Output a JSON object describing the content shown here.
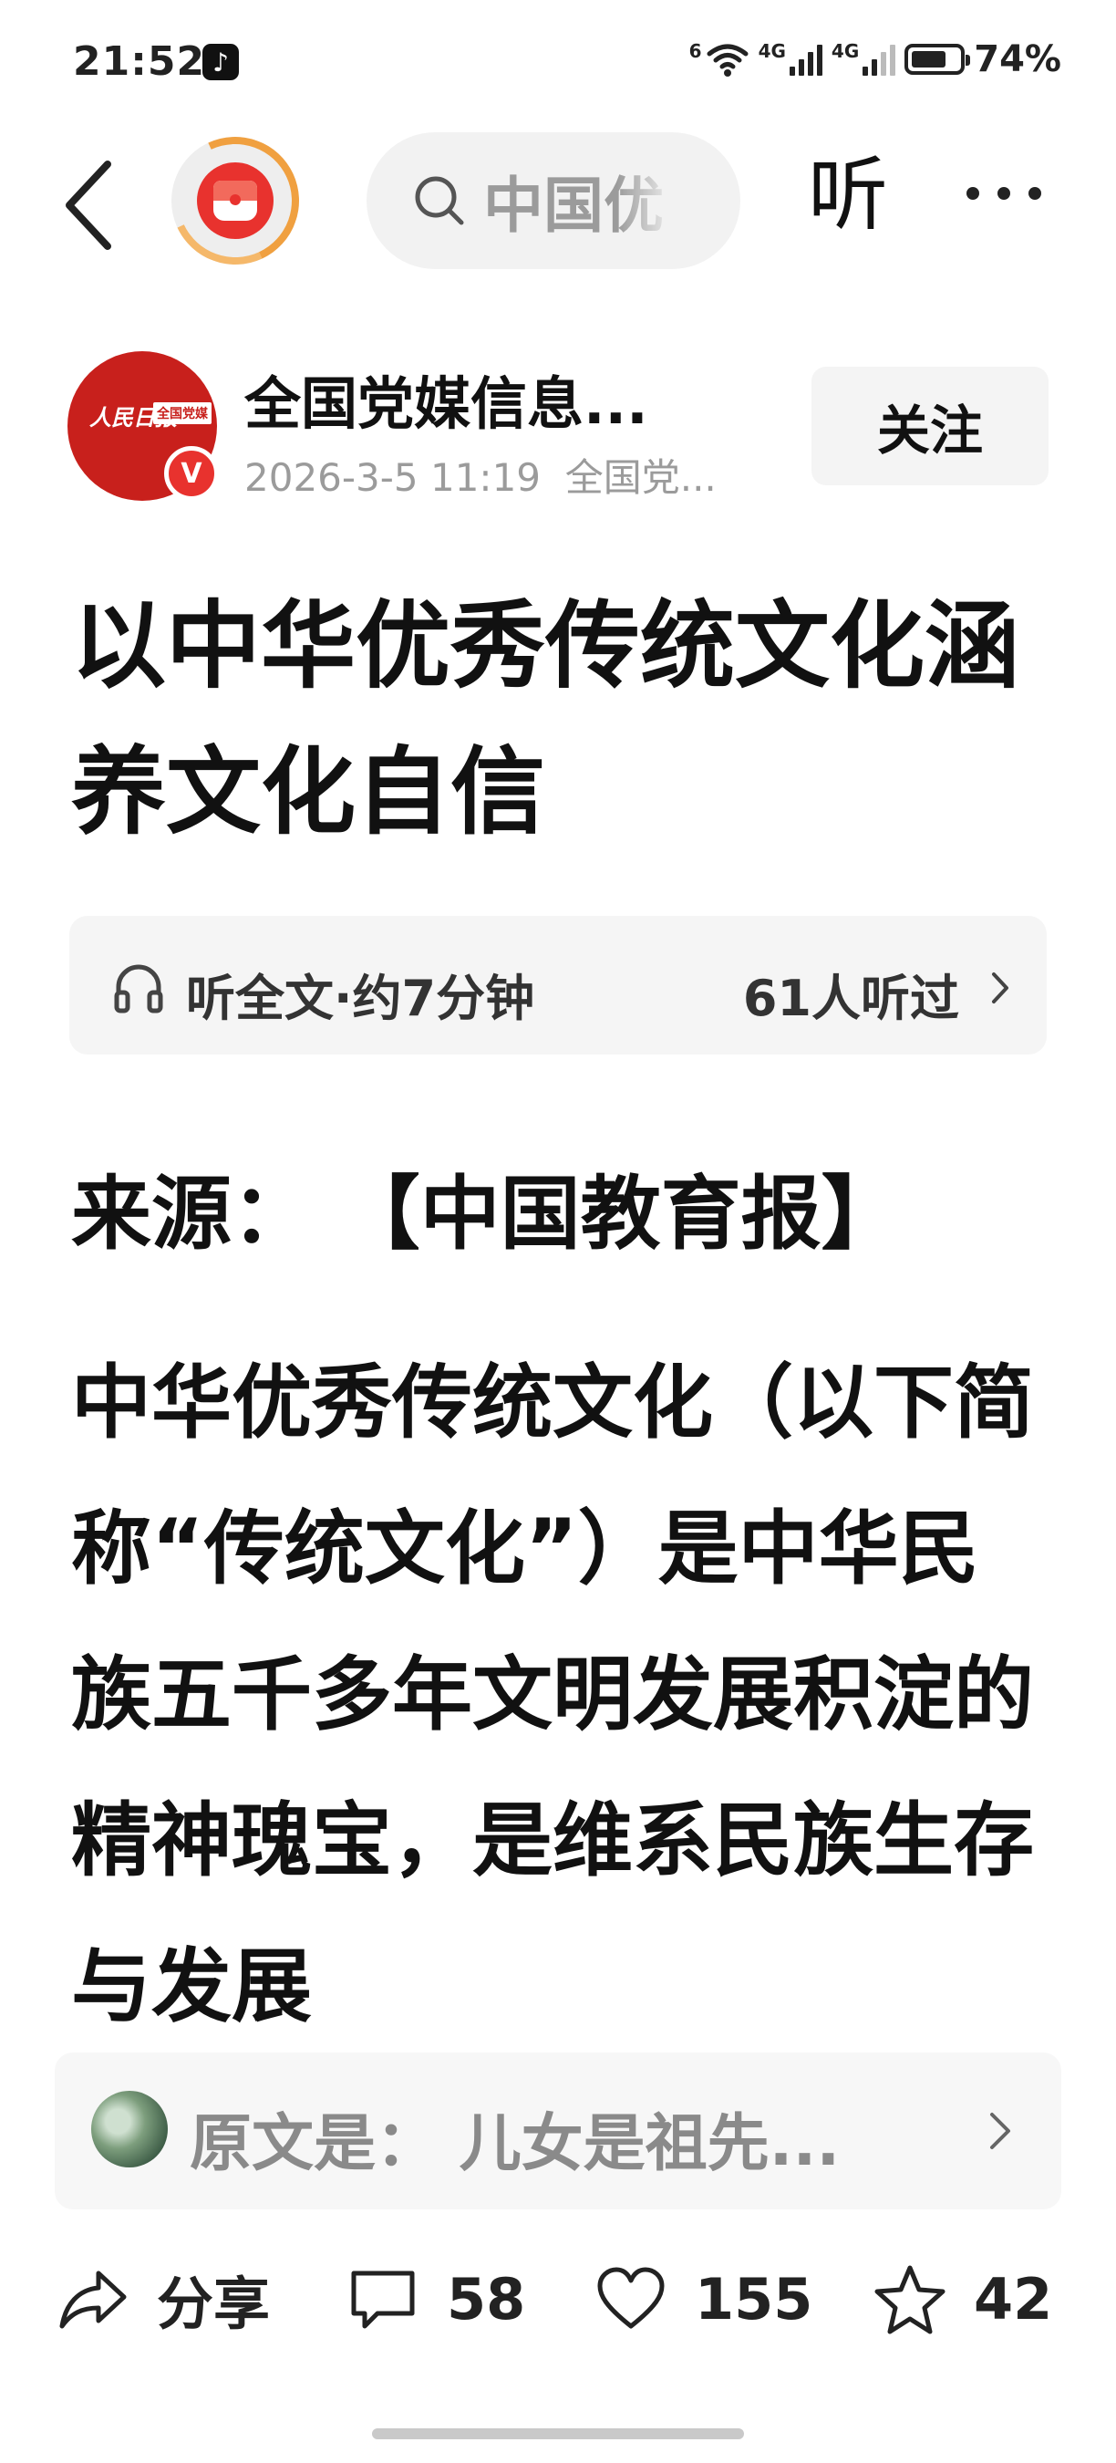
{
  "status_bar": {
    "time": "21:52",
    "app_badge": "♪",
    "wifi_tag": "6",
    "net1": "4G",
    "net2": "4G",
    "battery_percent": "74%",
    "battery_level": 0.74
  },
  "nav": {
    "search_text": "中国优",
    "listen_label": "听"
  },
  "author": {
    "name": "全国党媒信息...",
    "date": "2026-3-5 11:19",
    "source_short": "全国党...",
    "avatar_text": "人民日报",
    "avatar_tag": "全国党媒",
    "verified_mark": "V",
    "follow_label": "关注"
  },
  "article": {
    "title": "以中华优秀传统文化涵养文化自信",
    "audio_label": "听全文·约7分钟",
    "audio_count": "61人听过",
    "source_line": "来源：  【中国教育报】",
    "body": "中华优秀传统文化（以下简称“传统文化”）是中华民族五千多年文明发展积淀的精神瑰宝，是维系民族生存与发展"
  },
  "origin_card": {
    "text": "原文是：  儿女是祖先..."
  },
  "actions": {
    "share_label": "分享",
    "comments": "58",
    "likes": "155",
    "favorites": "42"
  }
}
